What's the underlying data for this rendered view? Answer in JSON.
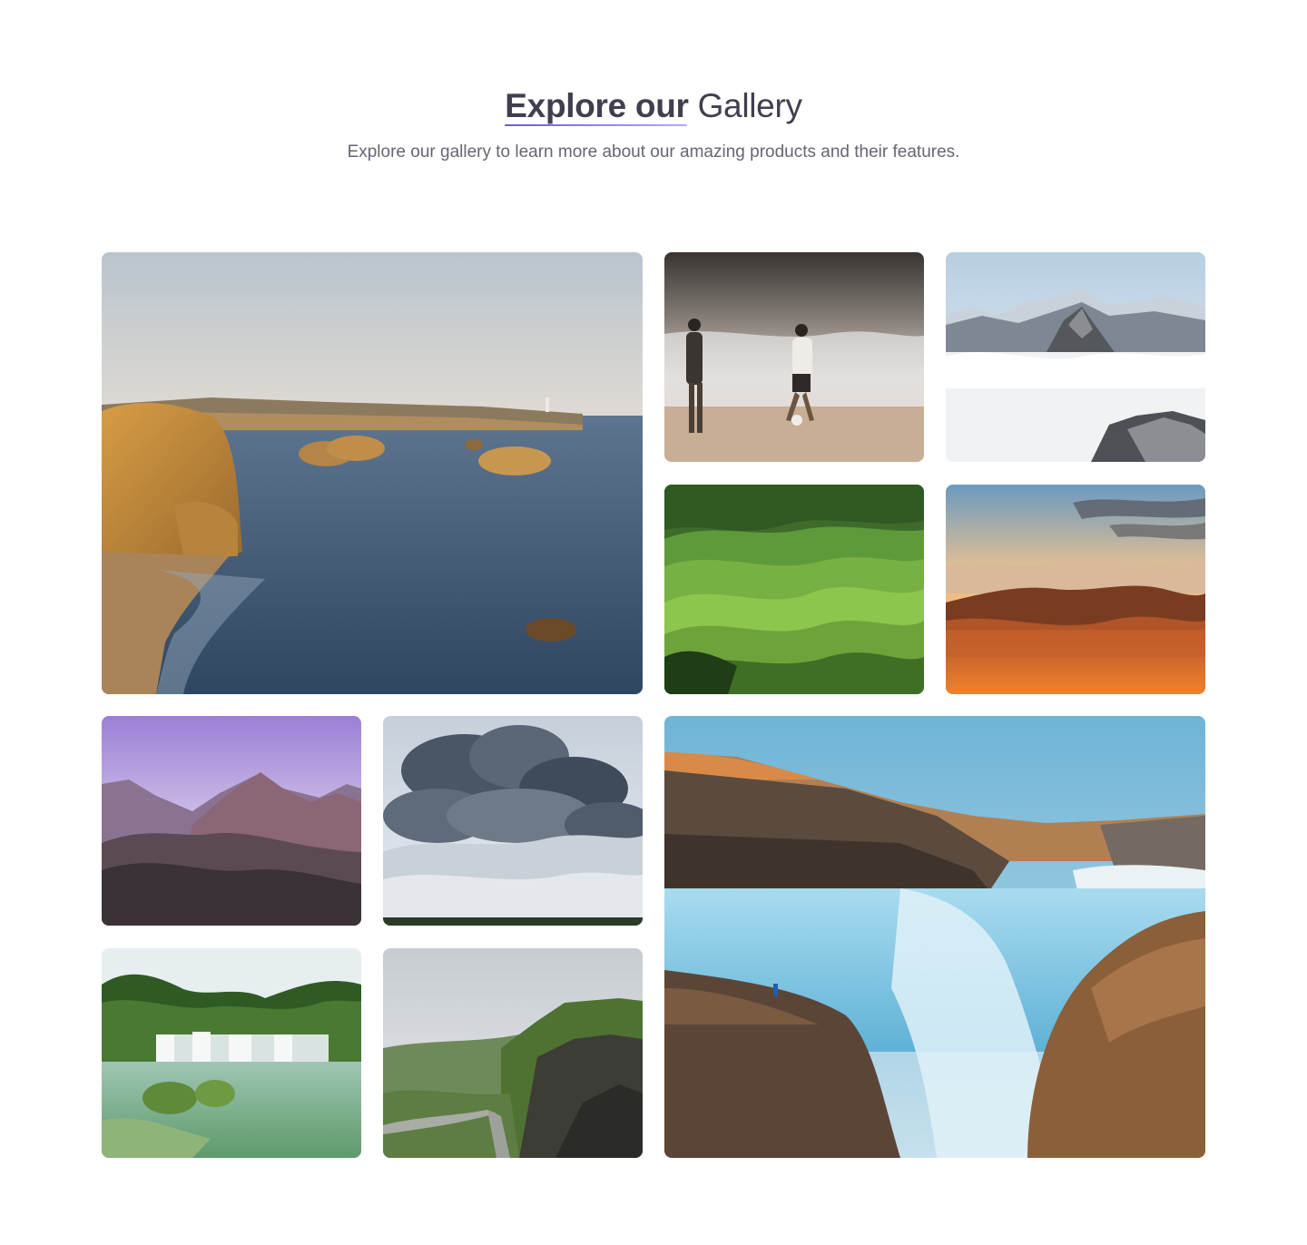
{
  "header": {
    "title_accent": "Explore our",
    "title_rest": "Gallery",
    "subtitle": "Explore our gallery to learn more about our amazing products and their features."
  },
  "gallery": {
    "images": [
      {
        "name": "coastal-cliffs-sea"
      },
      {
        "name": "beach-football-players"
      },
      {
        "name": "snowy-peaks-clouds"
      },
      {
        "name": "green-rolling-hills"
      },
      {
        "name": "sunset-mountain-clouds"
      },
      {
        "name": "purple-sky-mountains"
      },
      {
        "name": "storm-cloud-plume"
      },
      {
        "name": "waterfall-lagoon"
      },
      {
        "name": "green-cliffs-road"
      },
      {
        "name": "canyon-waterfall"
      }
    ]
  },
  "colors": {
    "title": "#3f3f4e",
    "subtitle": "#666673",
    "accent_underline": "#6d5bd0"
  }
}
